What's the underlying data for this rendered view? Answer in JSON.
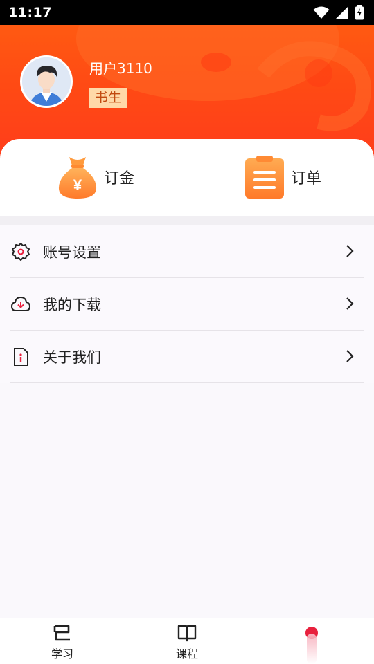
{
  "status_bar": {
    "time": "11:17"
  },
  "profile": {
    "username": "用户3110",
    "badge": "书生"
  },
  "quick_actions": [
    {
      "label": "订金",
      "icon": "money-bag-icon"
    },
    {
      "label": "订单",
      "icon": "clipboard-icon"
    }
  ],
  "menu": {
    "items": [
      {
        "label": "账号设置",
        "icon": "gear-icon"
      },
      {
        "label": "我的下载",
        "icon": "cloud-download-icon"
      },
      {
        "label": "关于我们",
        "icon": "info-document-icon"
      }
    ]
  },
  "tabbar": {
    "tabs": [
      {
        "label": "学习",
        "icon": "stack-icon"
      },
      {
        "label": "课程",
        "icon": "open-book-icon"
      },
      {
        "label": "",
        "icon": "active-dot-icon"
      }
    ]
  },
  "colors": {
    "brand": "#ff4a14",
    "badge_bg": "#ffd9a8",
    "accent_dot": "#e8203d"
  }
}
